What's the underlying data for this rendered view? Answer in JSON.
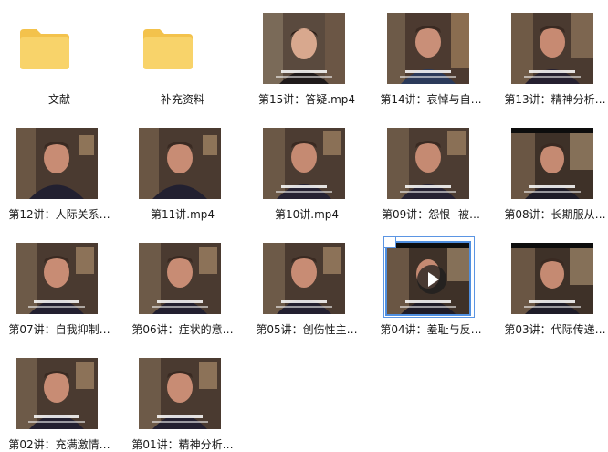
{
  "folders": [
    {
      "label": "文献"
    },
    {
      "label": "补充资料"
    }
  ],
  "videos": [
    {
      "label": "第15讲：答疑.mp4"
    },
    {
      "label": "第14讲：哀悼与自…"
    },
    {
      "label": "第13讲：精神分析…"
    },
    {
      "label": "第12讲：人际关系…"
    },
    {
      "label": "第11讲.mp4"
    },
    {
      "label": "第10讲.mp4"
    },
    {
      "label": "第09讲：怨恨--被…"
    },
    {
      "label": "第08讲：长期服从…"
    },
    {
      "label": "第07讲：自我抑制…"
    },
    {
      "label": "第06讲：症状的意…"
    },
    {
      "label": "第05讲：创伤性主…"
    },
    {
      "label": "第04讲：羞耻与反…"
    },
    {
      "label": "第03讲：代际传递…"
    },
    {
      "label": "第02讲：充满激情…"
    },
    {
      "label": "第01讲：精神分析…"
    }
  ],
  "colors": {
    "folder": "#f8d36a",
    "folder_tab": "#f3c24c",
    "selection": "#5b95e3"
  }
}
